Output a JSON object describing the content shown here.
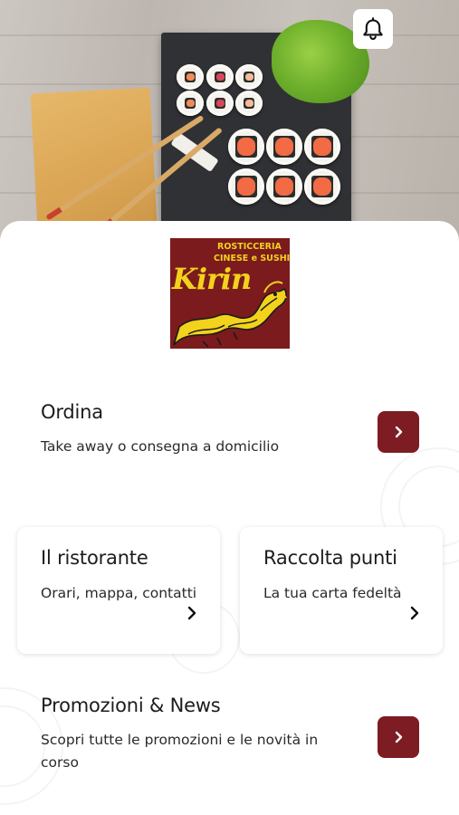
{
  "header": {
    "notifications_icon": "bell-icon"
  },
  "brand": {
    "logo_line1": "ROSTICCERIA",
    "logo_line2": "CINESE e SUSHI",
    "logo_wordmark": "Kirin",
    "logo_bg": "#7b1b1d",
    "logo_fg": "#f3d21c"
  },
  "order": {
    "title": "Ordina",
    "subtitle": "Take away o consegna a domicilio",
    "action_icon": "chevron-right-icon"
  },
  "restaurant": {
    "title": "Il ristorante",
    "subtitle": "Orari, mappa, contatti",
    "action_icon": "chevron-right-icon"
  },
  "loyalty": {
    "title": "Raccolta punti",
    "subtitle": "La tua carta fedeltà",
    "action_icon": "chevron-right-icon"
  },
  "promotions": {
    "title": "Promozioni & News",
    "subtitle": "Scopri tutte le promozioni e le novità in corso",
    "action_icon": "chevron-right-icon"
  },
  "colors": {
    "accent": "#7d1c23",
    "text": "#1c1c1c",
    "background": "#ffffff"
  }
}
